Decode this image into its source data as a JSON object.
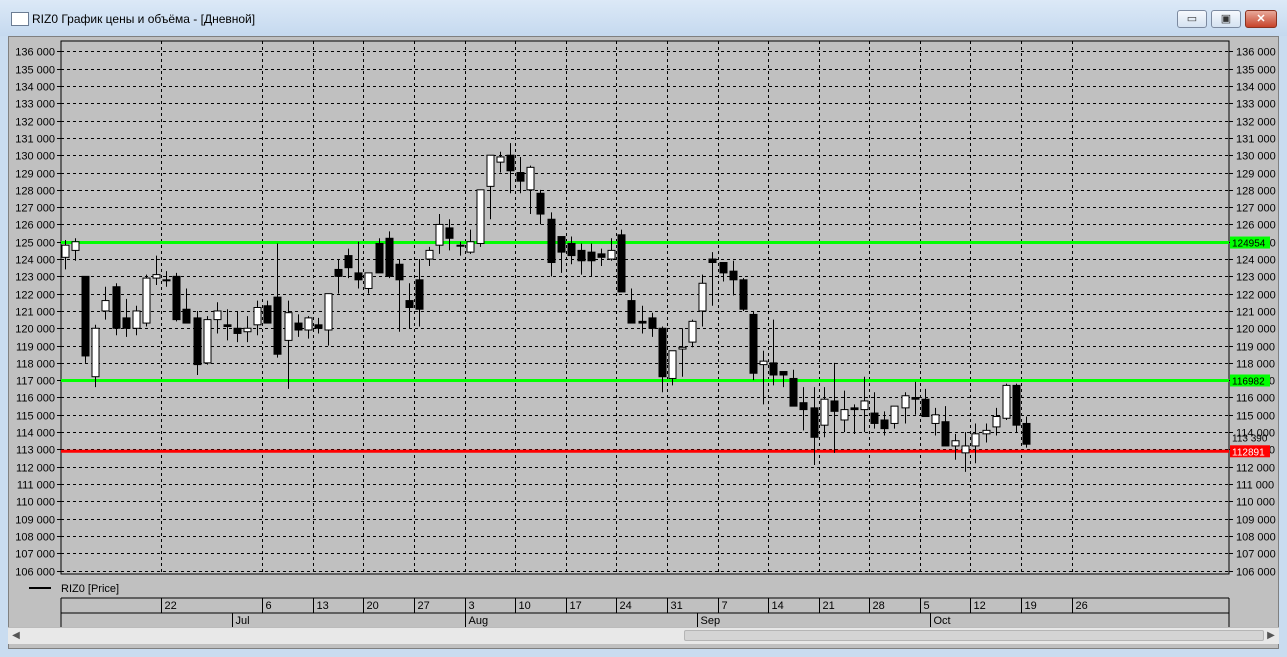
{
  "window": {
    "title": "RIZ0 График цены и объёма - [Дневной]",
    "minimize_glyph": "▭",
    "maximize_glyph": "▣",
    "close_glyph": "✕"
  },
  "chart_data": {
    "type": "candlestick",
    "title": "",
    "series_name": "RIZ0 [Price]",
    "ylim": [
      105800,
      136600
    ],
    "y_ticks": [
      106000,
      107000,
      108000,
      109000,
      110000,
      111000,
      112000,
      113000,
      114000,
      115000,
      116000,
      117000,
      118000,
      119000,
      120000,
      121000,
      122000,
      123000,
      124000,
      125000,
      126000,
      127000,
      128000,
      129000,
      130000,
      131000,
      132000,
      133000,
      134000,
      135000,
      136000
    ],
    "y_tick_labels": [
      "106 000",
      "107 000",
      "108 000",
      "109 000",
      "110 000",
      "111 000",
      "112 000",
      "113 000",
      "114 000",
      "115 000",
      "116 000",
      "117 000",
      "118 000",
      "119 000",
      "120 000",
      "121 000",
      "122 000",
      "123 000",
      "124 000",
      "125 000",
      "126 000",
      "127 000",
      "128 000",
      "129 000",
      "130 000",
      "131 000",
      "132 000",
      "133 000",
      "134 000",
      "135 000",
      "136 000"
    ],
    "grid": true,
    "day_ticks": [
      {
        "label": "22",
        "bar": 10
      },
      {
        "label": "6",
        "bar": 20
      },
      {
        "label": "13",
        "bar": 25
      },
      {
        "label": "20",
        "bar": 30
      },
      {
        "label": "27",
        "bar": 35
      },
      {
        "label": "3",
        "bar": 40
      },
      {
        "label": "10",
        "bar": 45
      },
      {
        "label": "17",
        "bar": 50
      },
      {
        "label": "24",
        "bar": 55
      },
      {
        "label": "31",
        "bar": 60
      },
      {
        "label": "7",
        "bar": 65
      },
      {
        "label": "14",
        "bar": 70
      },
      {
        "label": "21",
        "bar": 75
      },
      {
        "label": "28",
        "bar": 80
      },
      {
        "label": "5",
        "bar": 85
      },
      {
        "label": "12",
        "bar": 90
      },
      {
        "label": "19",
        "bar": 95
      },
      {
        "label": "26",
        "bar": 100
      }
    ],
    "month_ticks": [
      {
        "label": "Jul",
        "bar": 17
      },
      {
        "label": "Aug",
        "bar": 40
      },
      {
        "label": "Sep",
        "bar": 63
      },
      {
        "label": "Oct",
        "bar": 86
      }
    ],
    "horizontal_lines": [
      {
        "value": 124954,
        "label": "124954",
        "color": "#00ff00"
      },
      {
        "value": 116982,
        "label": "116982",
        "color": "#00ff00"
      },
      {
        "value": 112891,
        "label": "112891",
        "color": "#ff0000"
      }
    ],
    "last_price_label": "113 390",
    "candles": [
      [
        124100,
        125100,
        123400,
        124800
      ],
      [
        124500,
        125200,
        123900,
        125000
      ],
      [
        123000,
        123000,
        118000,
        118400
      ],
      [
        117200,
        120200,
        116600,
        120000
      ],
      [
        121000,
        122400,
        120500,
        121600
      ],
      [
        122400,
        122600,
        119600,
        120000
      ],
      [
        120600,
        121700,
        119500,
        120000
      ],
      [
        120000,
        121300,
        119600,
        121000
      ],
      [
        120300,
        123100,
        120100,
        122900
      ],
      [
        122900,
        124200,
        122500,
        123100
      ],
      [
        122800,
        123300,
        122400,
        122800
      ],
      [
        123000,
        123200,
        120400,
        120500
      ],
      [
        121100,
        122300,
        120300,
        120300
      ],
      [
        120600,
        121000,
        117300,
        117900
      ],
      [
        118000,
        120700,
        117900,
        120500
      ],
      [
        120500,
        121500,
        119700,
        121000
      ],
      [
        120200,
        121100,
        119300,
        120100
      ],
      [
        120000,
        121000,
        119200,
        119700
      ],
      [
        119800,
        120700,
        119200,
        120000
      ],
      [
        120200,
        121600,
        119600,
        121200
      ],
      [
        121300,
        121600,
        120300,
        120300
      ],
      [
        121800,
        124900,
        118300,
        118500
      ],
      [
        119300,
        121600,
        116500,
        120900
      ],
      [
        120300,
        120800,
        119500,
        119900
      ],
      [
        119900,
        120700,
        119400,
        120600
      ],
      [
        120200,
        120600,
        119700,
        120000
      ],
      [
        119900,
        121800,
        119000,
        122000
      ],
      [
        123400,
        124000,
        122000,
        123000
      ],
      [
        124200,
        124600,
        122900,
        123500
      ],
      [
        123200,
        125000,
        122300,
        122800
      ],
      [
        122300,
        123200,
        122000,
        123200
      ],
      [
        124900,
        125200,
        123500,
        123200
      ],
      [
        125200,
        125600,
        122900,
        123000
      ],
      [
        123700,
        124000,
        119800,
        122800
      ],
      [
        121600,
        122600,
        120000,
        121200
      ],
      [
        122800,
        124000,
        120100,
        121100
      ],
      [
        124000,
        124700,
        123600,
        124500
      ],
      [
        124800,
        126600,
        124300,
        126000
      ],
      [
        125800,
        126300,
        124500,
        125200
      ],
      [
        124800,
        125000,
        124200,
        124800
      ],
      [
        124400,
        125700,
        124300,
        125000
      ],
      [
        124900,
        126000,
        124700,
        128000
      ],
      [
        128200,
        129900,
        126300,
        130000
      ],
      [
        129600,
        130200,
        129000,
        129900
      ],
      [
        130000,
        130700,
        127800,
        129100
      ],
      [
        129000,
        129900,
        127800,
        128500
      ],
      [
        128000,
        129400,
        126600,
        129300
      ],
      [
        127800,
        128000,
        126000,
        126600
      ],
      [
        126300,
        126700,
        123000,
        123800
      ],
      [
        125300,
        125300,
        123200,
        124400
      ],
      [
        124900,
        125300,
        123700,
        124200
      ],
      [
        124500,
        124900,
        123100,
        123900
      ],
      [
        124400,
        124900,
        123000,
        123900
      ],
      [
        124300,
        124600,
        123600,
        124100
      ],
      [
        124000,
        125200,
        123900,
        124500
      ],
      [
        125400,
        125700,
        122300,
        122100
      ],
      [
        121600,
        122300,
        120700,
        120300
      ],
      [
        120400,
        121300,
        119700,
        120300
      ],
      [
        120600,
        120900,
        119500,
        120000
      ],
      [
        120000,
        120100,
        116300,
        117200
      ],
      [
        117100,
        118700,
        116700,
        118700
      ],
      [
        118800,
        120000,
        117200,
        118900
      ],
      [
        119200,
        120500,
        118900,
        120400
      ],
      [
        121000,
        123100,
        120100,
        122600
      ],
      [
        124000,
        124400,
        121300,
        123800
      ],
      [
        123800,
        123800,
        122700,
        123200
      ],
      [
        123300,
        123900,
        121900,
        122800
      ],
      [
        122800,
        122900,
        121000,
        121100
      ],
      [
        120800,
        121000,
        117000,
        117400
      ],
      [
        117900,
        118700,
        115600,
        118100
      ],
      [
        118000,
        120500,
        116700,
        117300
      ],
      [
        117500,
        117500,
        116600,
        117300
      ],
      [
        117100,
        117600,
        115700,
        115500
      ],
      [
        115700,
        116600,
        114100,
        115300
      ],
      [
        115400,
        116600,
        112100,
        113700
      ],
      [
        114400,
        116600,
        113700,
        115900
      ],
      [
        115800,
        118000,
        112800,
        115200
      ],
      [
        114700,
        116400,
        114000,
        115300
      ],
      [
        115400,
        115600,
        113900,
        115300
      ],
      [
        115300,
        117200,
        114000,
        115800
      ],
      [
        115100,
        116300,
        114200,
        114500
      ],
      [
        114700,
        115200,
        113800,
        114200
      ],
      [
        114500,
        115200,
        114200,
        115500
      ],
      [
        115400,
        116300,
        114500,
        116100
      ],
      [
        116000,
        116900,
        115000,
        115900
      ],
      [
        115900,
        116500,
        114900,
        114900
      ],
      [
        114500,
        115400,
        113800,
        115000
      ],
      [
        114600,
        115500,
        113200,
        113200
      ],
      [
        113200,
        113900,
        112400,
        113500
      ],
      [
        112800,
        114000,
        111700,
        113200
      ],
      [
        113200,
        114500,
        112200,
        113900
      ],
      [
        113900,
        114500,
        113400,
        114100
      ],
      [
        114300,
        115400,
        113800,
        114900
      ],
      [
        114800,
        116800,
        114700,
        116700
      ],
      [
        116700,
        116800,
        114000,
        114400
      ],
      [
        114500,
        114900,
        113100,
        113300
      ]
    ]
  }
}
